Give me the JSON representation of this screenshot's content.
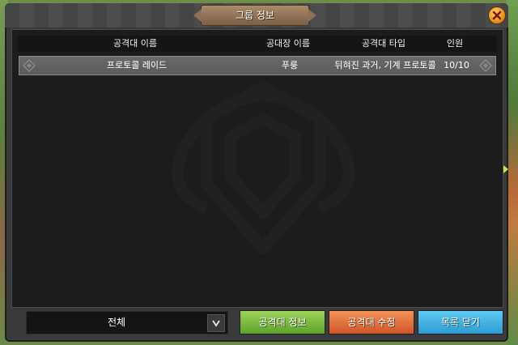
{
  "window": {
    "title": "그룹 정보"
  },
  "table": {
    "headers": [
      "공격대 이름",
      "공대장 이름",
      "공격대 타입",
      "인원"
    ],
    "rows": [
      {
        "name": "프로토콜 레이드",
        "leader": "푸룽",
        "type": "뒤혀진 과거, 기계 프로토콜",
        "count": "10/10"
      }
    ]
  },
  "filter": {
    "selected": "전체"
  },
  "buttons": {
    "info": "공격대 정보",
    "edit": "공격대 수정",
    "close": "목록 닫기"
  },
  "colors": {
    "info": "#7cc043",
    "edit": "#e5713f",
    "close": "#3db3e6",
    "accent_title": "#8d6f52"
  },
  "icons": {
    "close": "close-x-icon",
    "dropdown": "chevron-down-icon"
  }
}
